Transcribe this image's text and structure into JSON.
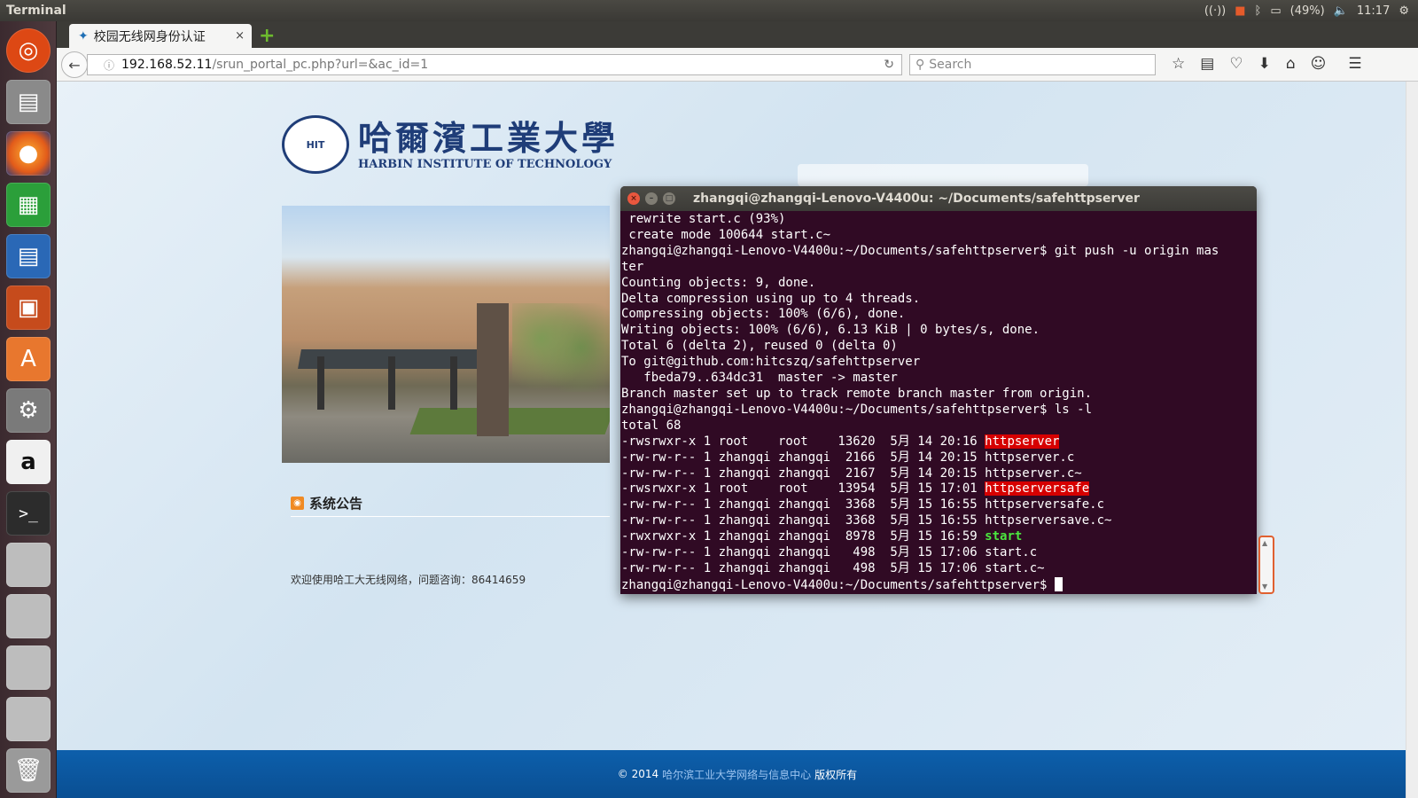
{
  "topbar": {
    "app_name": "Terminal",
    "battery": "(49%)",
    "time": "11:17"
  },
  "launcher": {
    "items": [
      "ubuntu-dash",
      "files",
      "firefox",
      "libreoffice-calc",
      "libreoffice-writer",
      "libreoffice-impress",
      "ubuntu-software",
      "system-settings",
      "amazon",
      "terminal",
      "disk-1",
      "disk-2",
      "disk-3",
      "disk-4",
      "trash"
    ]
  },
  "browser": {
    "tab_title": "校园无线网身份认证",
    "tab_close": "×",
    "new_tab": "+",
    "url_host": "192.168.52.11",
    "url_path": "/srun_portal_pc.php?url=&ac_id=1",
    "search_placeholder": "Search"
  },
  "page": {
    "logo_cn": "哈爾濱工業大學",
    "logo_en": "HARBIN INSTITUTE OF TECHNOLOGY",
    "announce_title": "系统公告",
    "welcome": "欢迎使用哈工大无线网络，问题咨询：86414659",
    "footer_prefix": "© 2014",
    "footer_link": "哈尔滨工业大学网络与信息中心",
    "footer_suffix": "版权所有"
  },
  "terminal": {
    "title": "zhangqi@zhangqi-Lenovo-V4400u: ~/Documents/safehttpserver",
    "lines": [
      {
        "text": " rewrite start.c (93%)"
      },
      {
        "text": " create mode 100644 start.c~"
      },
      {
        "text": "zhangqi@zhangqi-Lenovo-V4400u:~/Documents/safehttpserver$ git push -u origin mas"
      },
      {
        "text": "ter"
      },
      {
        "text": "Counting objects: 9, done."
      },
      {
        "text": "Delta compression using up to 4 threads."
      },
      {
        "text": "Compressing objects: 100% (6/6), done."
      },
      {
        "text": "Writing objects: 100% (6/6), 6.13 KiB | 0 bytes/s, done."
      },
      {
        "text": "Total 6 (delta 2), reused 0 (delta 0)"
      },
      {
        "text": "To git@github.com:hitcszq/safehttpserver"
      },
      {
        "text": "   fbeda79..634dc31  master -> master"
      },
      {
        "text": "Branch master set up to track remote branch master from origin."
      },
      {
        "text": "zhangqi@zhangqi-Lenovo-V4400u:~/Documents/safehttpserver$ ls -l"
      },
      {
        "text": "total 68"
      },
      {
        "text": "-rwsrwxr-x 1 root    root    13620  5月 14 20:16 ",
        "name": "httpserver",
        "style": "red"
      },
      {
        "text": "-rw-rw-r-- 1 zhangqi zhangqi  2166  5月 14 20:15 httpserver.c"
      },
      {
        "text": "-rw-rw-r-- 1 zhangqi zhangqi  2167  5月 14 20:15 httpserver.c~"
      },
      {
        "text": "-rwsrwxr-x 1 root    root    13954  5月 15 17:01 ",
        "name": "httpserversafe",
        "style": "red"
      },
      {
        "text": "-rw-rw-r-- 1 zhangqi zhangqi  3368  5月 15 16:55 httpserversafe.c"
      },
      {
        "text": "-rw-rw-r-- 1 zhangqi zhangqi  3368  5月 15 16:55 httpserversave.c~"
      },
      {
        "text": "-rwxrwxr-x 1 zhangqi zhangqi  8978  5月 15 16:59 ",
        "name": "start",
        "style": "green"
      },
      {
        "text": "-rw-rw-r-- 1 zhangqi zhangqi   498  5月 15 17:06 start.c"
      },
      {
        "text": "-rw-rw-r-- 1 zhangqi zhangqi   498  5月 15 17:06 start.c~"
      },
      {
        "text": "zhangqi@zhangqi-Lenovo-V4400u:~/Documents/safehttpserver$ ",
        "cursor": true
      }
    ]
  },
  "colors": {
    "terminal_bg": "#300a24",
    "footer_bg": "#0d5fab",
    "highlight_red": "#d60000",
    "exec_green": "#4be63f"
  }
}
